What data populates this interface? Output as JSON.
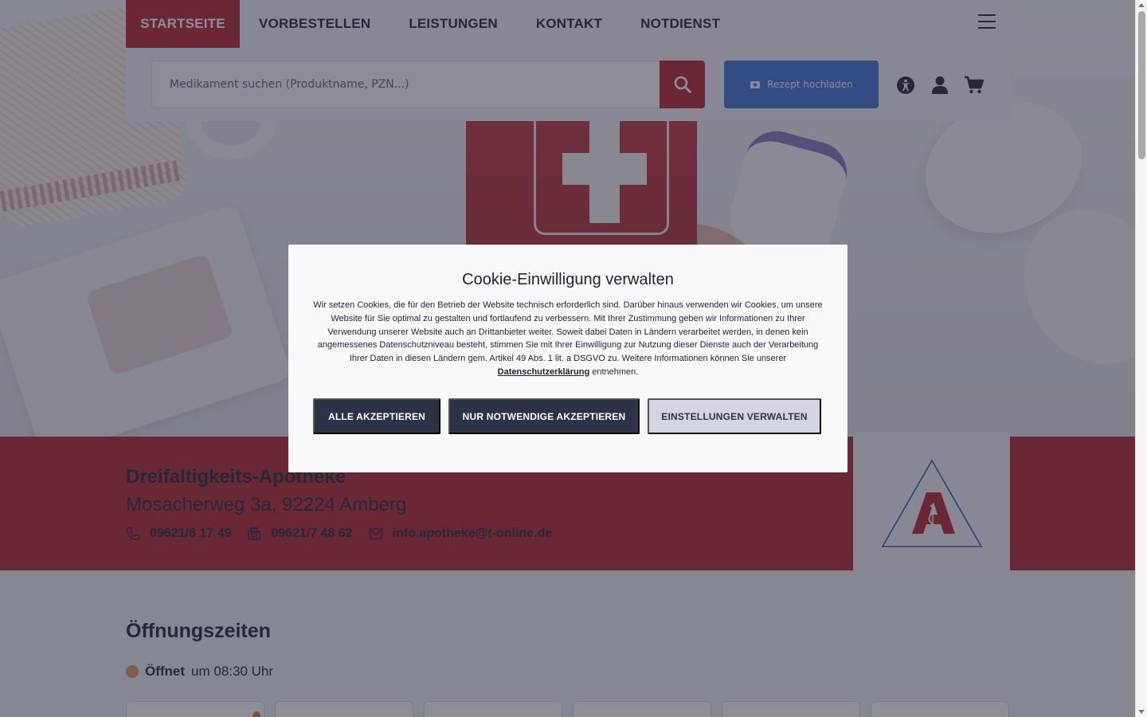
{
  "nav": {
    "items": [
      {
        "label": "STARTSEITE",
        "active": true
      },
      {
        "label": "VORBESTELLEN"
      },
      {
        "label": "LEISTUNGEN"
      },
      {
        "label": "KONTAKT"
      },
      {
        "label": "NOTDIENST"
      }
    ]
  },
  "search": {
    "placeholder": "Medikament suchen (Produktname, PZN...)",
    "value": ""
  },
  "rezept_button": {
    "label": "Rezept hochladen"
  },
  "pharmacy": {
    "name": "Dreifaltigkeits-Apotheke",
    "address": "Mosacherweg 3a, 92224 Amberg",
    "phone": "09621/8 17 49",
    "fax": "09621/7 48 62",
    "email": "info.apotheke@t-online.de"
  },
  "hours": {
    "title": "Öffnungszeiten",
    "status_label": "Öffnet",
    "status_time": "um 08:30 Uhr"
  },
  "cookie": {
    "title": "Cookie-Einwilligung verwalten",
    "text_before_link": "Wir setzen Cookies, die für den Betrieb der Website technisch erforderlich sind. Darüber hinaus verwenden wir Cookies, um unsere Website für Sie optimal zu gestalten und fortlaufend zu verbessern. Mit Ihrer Zustimmung geben wir Informationen zu Ihrer Verwendung unserer Website auch an Drittanbieter weiter. Soweit dabei Daten in Ländern verarbeitet werden, in denen kein angemessenes Datenschutzniveau besteht, stimmen Sie mit Ihrer Einwilligung zur Nutzung dieser Dienste auch der Verarbeitung Ihrer Daten in diesen Ländern gem. Artikel 49 Abs. 1 lit. a DSGVO zu. Weitere Informationen können Sie unserer",
    "link": "Datenschutzerklärung",
    "text_after_link": "entnehmen.",
    "accept_all": "ALLE AKZEPTIEREN",
    "accept_necessary": "NUR NOTWENDIGE AKZEPTIEREN",
    "settings": "EINSTELLUNGEN VERWALTEN"
  },
  "colors": {
    "brand_red": "#b8323a",
    "accent_blue": "#4a7ad8",
    "dark_button": "#2c3346",
    "status_dot": "#f09a5e"
  },
  "icons": [
    "search-icon",
    "prescription-icon",
    "accessibility-icon",
    "user-icon",
    "cart-icon",
    "menu-icon",
    "phone-icon",
    "fax-icon",
    "mail-icon",
    "pharmacy-logo"
  ]
}
